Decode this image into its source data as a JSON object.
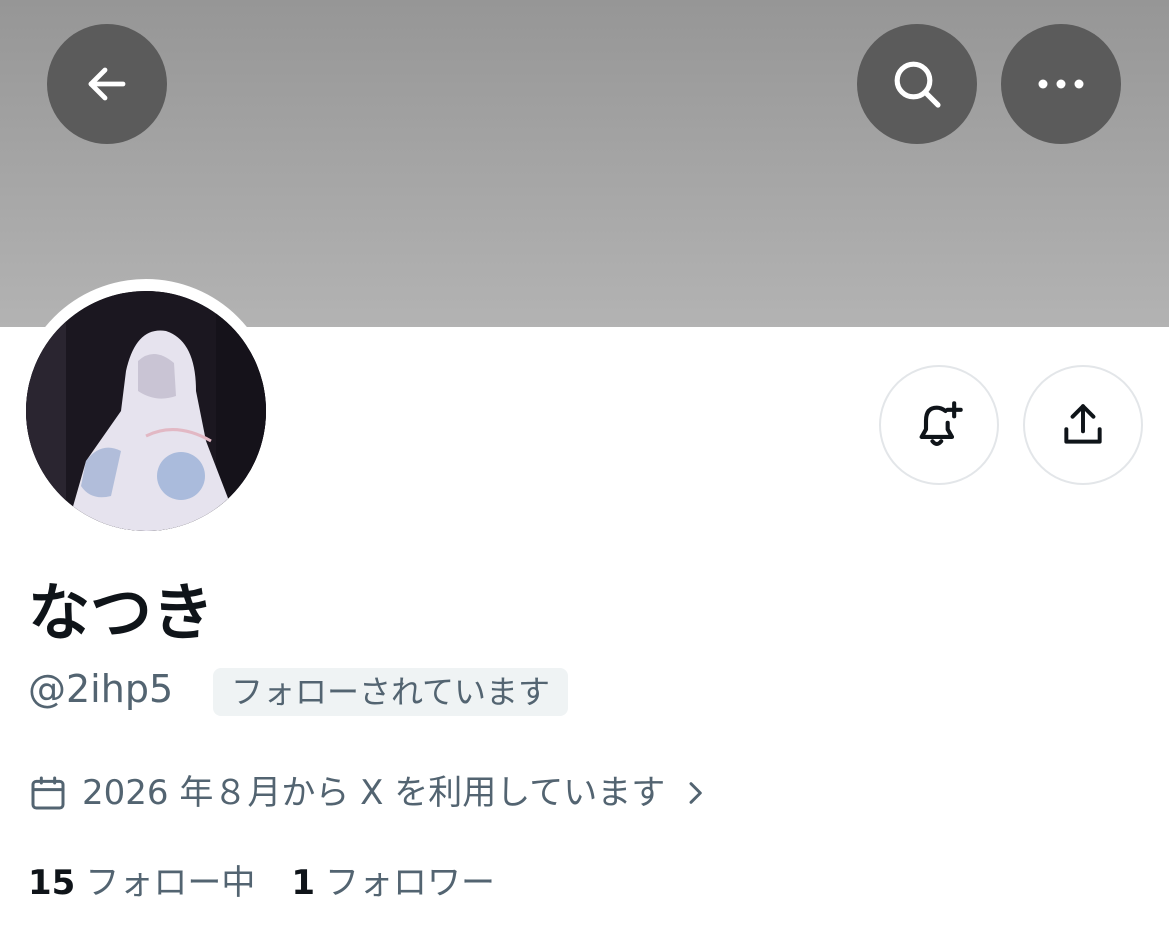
{
  "header": {
    "back_icon": "arrow-left-icon",
    "search_icon": "search-icon",
    "more_icon": "more-horizontal-icon"
  },
  "profile": {
    "display_name": "なつき",
    "handle": "@2ihp5",
    "follows_you_badge": "フォローされています",
    "joined_text": "2026 年８月から X を利用しています",
    "avatar_description": "hooded-figure-photo"
  },
  "actions": {
    "notify_icon": "bell-plus-icon",
    "share_icon": "share-upload-icon"
  },
  "stats": {
    "following_count": "15",
    "following_label": "フォロー中",
    "followers_count": "1",
    "followers_label": "フォロワー"
  },
  "colors": {
    "banner_top": "#969696",
    "banner_bottom": "#b3b3b3",
    "header_button": "#5b5b5b",
    "secondary_text": "#536471",
    "primary_text": "#0f1419",
    "badge_bg": "#eff3f4"
  }
}
